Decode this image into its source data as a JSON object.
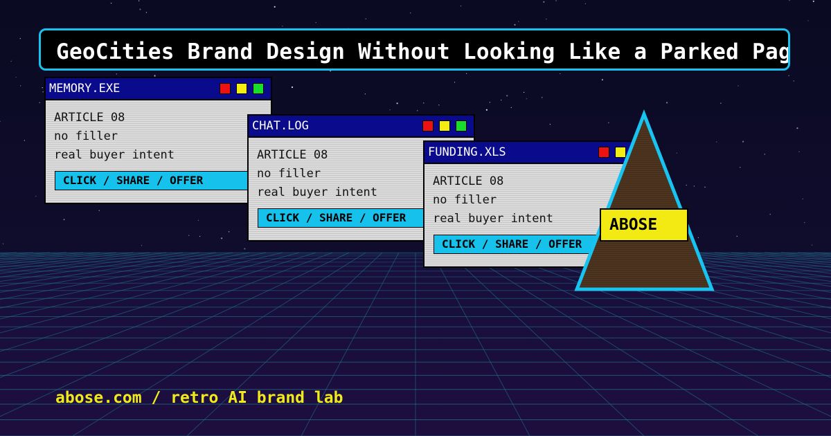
{
  "headline": "GeoCities Brand Design Without Looking Like a Parked Page",
  "windows": [
    {
      "title": "MEMORY.EXE",
      "lines": [
        "ARTICLE 08",
        "no filler",
        "real buyer intent"
      ],
      "cta": "CLICK / SHARE / OFFER"
    },
    {
      "title": "CHAT.LOG",
      "lines": [
        "ARTICLE 08",
        "no filler",
        "real buyer intent"
      ],
      "cta": "CLICK / SHARE / OFFER"
    },
    {
      "title": "FUNDING.XLS",
      "lines": [
        "ARTICLE 08",
        "no filler",
        "real buyer intent"
      ],
      "cta": "CLICK / SHARE / OFFER"
    }
  ],
  "badge": "ABOSE",
  "footer": "abose.com / retro AI brand lab",
  "colors": {
    "background": "#0b0a24",
    "accent_cyan": "#19c3f0",
    "accent_yellow": "#f3ea14",
    "titlebar_blue": "#0a0a8c",
    "pyramid_brown": "#4e3520",
    "grid_teal": "#1f6f86"
  }
}
